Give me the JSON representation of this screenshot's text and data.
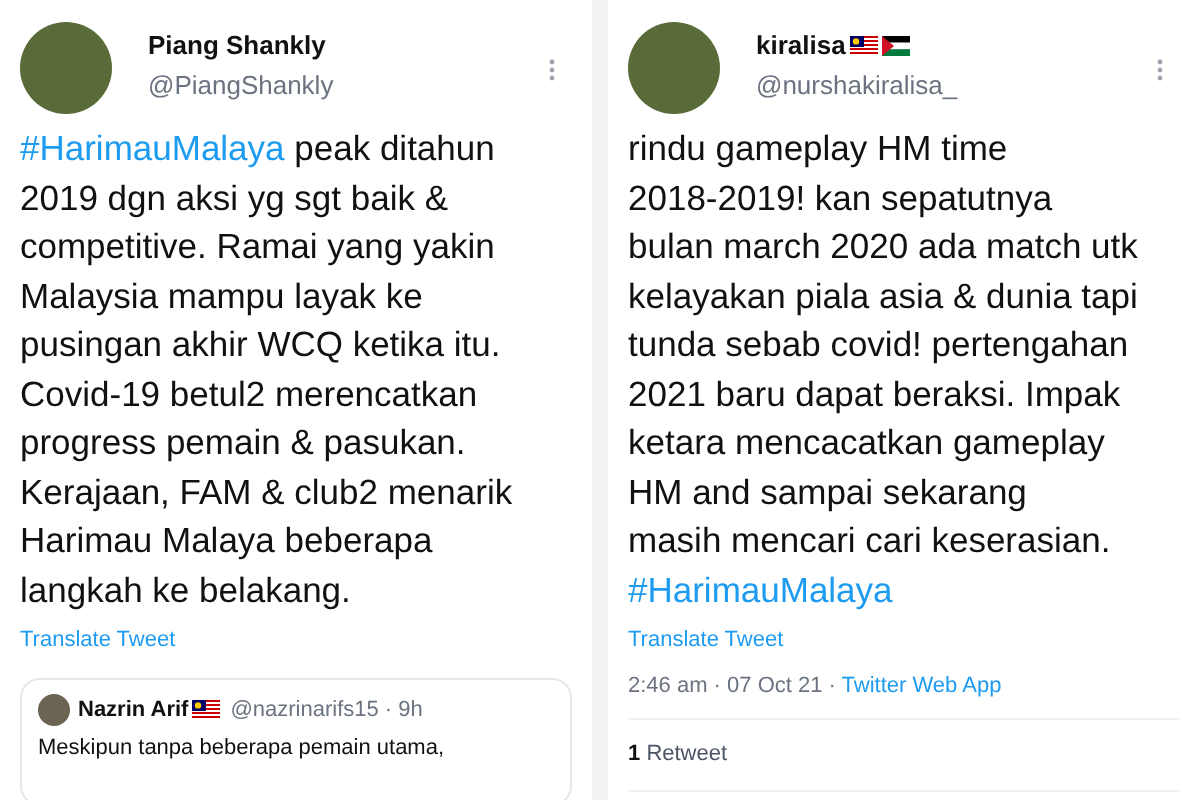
{
  "tweets": [
    {
      "name": "Piang Shankly",
      "handle": "@PiangShankly",
      "body": [
        {
          "kind": "hashtag",
          "text": "#HarimauMalaya"
        },
        {
          "kind": "text",
          "text": " peak ditahun\n2019 dgn aksi yg sgt baik &\ncompetitive. Ramai yang yakin\nMalaysia mampu layak ke\npusingan akhir WCQ ketika itu.\nCovid-19 betul2 merencatkan\nprogress pemain & pasukan.\nKerajaan, FAM & club2 menarik\nHarimau Malaya beberapa\nlangkah ke belakang."
        }
      ],
      "translate": "Translate Tweet",
      "quote": {
        "name": "Nazrin Arif",
        "flags": [
          {
            "kind": "malaysia"
          }
        ],
        "handle": "@nazrinarifs15",
        "time": "· 9h",
        "text": "Meskipun tanpa beberapa pemain utama,"
      }
    },
    {
      "name": "kiralisa",
      "flags": [
        {
          "kind": "malaysia"
        },
        {
          "kind": "palestine"
        }
      ],
      "handle": "@nurshakiralisa_",
      "body": [
        {
          "kind": "text",
          "text": "rindu gameplay HM time\n2018-2019! kan sepatutnya\nbulan march 2020 ada match utk\nkelayakan piala asia & dunia tapi\ntunda sebab covid! pertengahan\n2021 baru dapat beraksi. Impak\nketara mencacatkan gameplay\nHM and sampai sekarang\nmasih mencari cari keserasian.\n"
        },
        {
          "kind": "hashtag",
          "text": "#HarimauMalaya"
        }
      ],
      "translate": "Translate Tweet",
      "meta": {
        "time": "2:46 am · 07 Oct 21 · ",
        "source": "Twitter Web App"
      },
      "stats": {
        "count": "1",
        "label": "Retweet"
      }
    }
  ]
}
